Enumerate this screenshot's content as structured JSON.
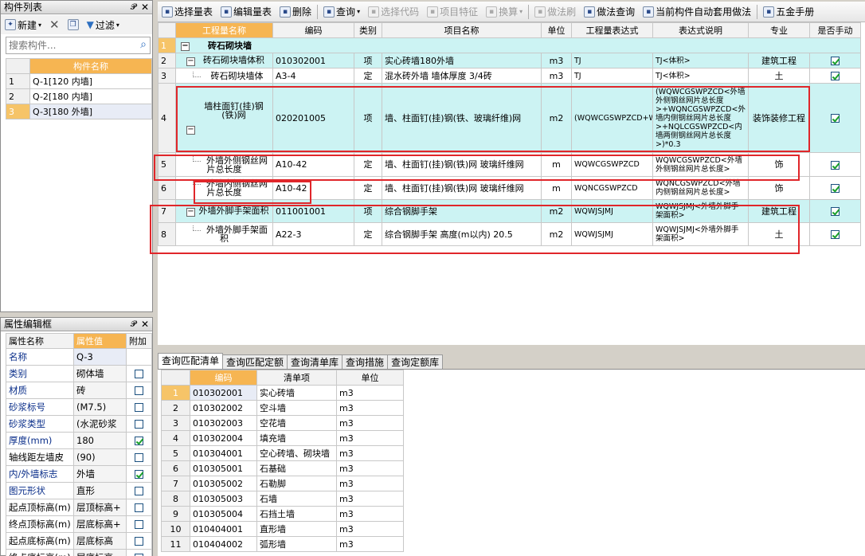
{
  "component_panel": {
    "title": "构件列表",
    "toolbar": {
      "new": "新建",
      "filter": "过滤"
    },
    "search_placeholder": "搜索构件...",
    "column": "构件名称",
    "items": [
      {
        "no": "1",
        "name": "Q-1[120 内墙]"
      },
      {
        "no": "2",
        "name": "Q-2[180 内墙]"
      },
      {
        "no": "3",
        "name": "Q-3[180 外墙]"
      }
    ]
  },
  "property_panel": {
    "title": "属性编辑框",
    "headers": {
      "name": "属性名称",
      "value": "属性值",
      "extra": "附加"
    },
    "rows": [
      {
        "name": "名称",
        "value": "Q-3",
        "check": null,
        "blue": true
      },
      {
        "name": "类别",
        "value": "砌体墙",
        "check": false,
        "blue": true
      },
      {
        "name": "材质",
        "value": "砖",
        "check": false,
        "blue": true
      },
      {
        "name": "砂浆标号",
        "value": "(M7.5)",
        "check": false,
        "blue": true
      },
      {
        "name": "砂浆类型",
        "value": "(水泥砂浆",
        "check": false,
        "blue": true
      },
      {
        "name": "厚度(mm)",
        "value": "180",
        "check": true,
        "blue": true
      },
      {
        "name": "轴线距左墙皮",
        "value": "(90)",
        "check": false,
        "blue": false
      },
      {
        "name": "内/外墙标志",
        "value": "外墙",
        "check": true,
        "blue": true
      },
      {
        "name": "图元形状",
        "value": "直形",
        "check": false,
        "blue": true
      },
      {
        "name": "起点顶标高(m)",
        "value": "层顶标高+",
        "check": false,
        "blue": false
      },
      {
        "name": "终点顶标高(m)",
        "value": "层底标高+",
        "check": false,
        "blue": false
      },
      {
        "name": "起点底标高(m)",
        "value": "层底标高",
        "check": false,
        "blue": false
      },
      {
        "name": "终点底标高(m)",
        "value": "层底标高",
        "check": false,
        "blue": false
      }
    ]
  },
  "main_toolbar": [
    {
      "label": "选择量表",
      "icon": "select-table-icon",
      "disabled": false
    },
    {
      "label": "编辑量表",
      "icon": "edit-table-icon",
      "disabled": false
    },
    {
      "label": "删除",
      "icon": "delete-icon",
      "disabled": false
    },
    {
      "label": "查询",
      "icon": "query-icon",
      "disabled": false,
      "dropdown": true
    },
    {
      "label": "选择代码",
      "icon": "select-code-icon",
      "disabled": true
    },
    {
      "label": "项目特征",
      "icon": "feature-icon",
      "disabled": true
    },
    {
      "label": "换算",
      "icon": "convert-icon",
      "disabled": true,
      "dropdown": true
    },
    {
      "label": "做法刷",
      "icon": "brush-icon",
      "disabled": true
    },
    {
      "label": "做法查询",
      "icon": "method-query-icon",
      "disabled": false
    },
    {
      "label": "当前构件自动套用做法",
      "icon": "auto-apply-icon",
      "disabled": false
    },
    {
      "label": "五金手册",
      "icon": "manual-icon",
      "disabled": false
    }
  ],
  "grid": {
    "headers": [
      "工程量名称",
      "编码",
      "类别",
      "项目名称",
      "单位",
      "工程量表达式",
      "表达式说明",
      "专业",
      "是否手动"
    ],
    "group": {
      "no": "1",
      "name": "砖石砌块墙"
    },
    "rows": [
      {
        "no": "2",
        "name": "砖石砌块墙体积",
        "code": "010302001",
        "type": "项",
        "proj": "实心砖墙180外墙",
        "unit": "m3",
        "expr": "TJ",
        "desc": "TJ<体积>",
        "spec": "建筑工程",
        "manual": true,
        "level": 1
      },
      {
        "no": "3",
        "name": "砖石砌块墙体",
        "code": "A3-4",
        "type": "定",
        "proj": "混水砖外墙 墙体厚度 3/4砖",
        "unit": "m3",
        "expr": "TJ",
        "desc": "TJ<体积>",
        "spec": "土",
        "manual": true,
        "level": 2
      },
      {
        "no": "4",
        "name": "墙柱面钉(挂)钢(铁)网",
        "code": "020201005",
        "type": "项",
        "proj": "墙、柱面钉(挂)钢(铁、玻璃纤维)网",
        "unit": "m2",
        "expr": "(WQWCGSWPZCD+WQNCGSWPZCD+NQLCGSWPZCD)*0.3",
        "desc": "(WQWCGSWPZCD<外墙外侧钢丝网片总长度>+WQNCGSWPZCD<外墙内侧钢丝网片总长度>+NQLCGSWPZCD<内墙两侧钢丝网片总长度>)*0.3",
        "spec": "装饰装修工程",
        "manual": true,
        "level": 1
      },
      {
        "no": "5",
        "name": "外墙外侧钢丝网片总长度",
        "code": "A10-42",
        "type": "定",
        "proj": "墙、柱面钉(挂)钢(铁)网 玻璃纤维网",
        "unit": "m",
        "expr": "WQWCGSWPZCD",
        "desc": "WQWCGSWPZCD<外墙外侧钢丝网片总长度>",
        "spec": "饰",
        "manual": true,
        "level": 2
      },
      {
        "no": "6",
        "name": "外墙内侧钢丝网片总长度",
        "code": "A10-42",
        "type": "定",
        "proj": "墙、柱面钉(挂)钢(铁)网 玻璃纤维网",
        "unit": "m",
        "expr": "WQNCGSWPZCD",
        "desc": "WQNCGSWPZCD<外墙内侧钢丝网片总长度>",
        "spec": "饰",
        "manual": true,
        "level": 2
      },
      {
        "no": "7",
        "name": "外墙外脚手架面积",
        "code": "011001001",
        "type": "项",
        "proj": "综合钢脚手架",
        "unit": "m2",
        "expr": "WQWJSJMJ",
        "desc": "WQWJSJMJ<外墙外脚手架面积>",
        "spec": "建筑工程",
        "manual": true,
        "level": 1
      },
      {
        "no": "8",
        "name": "外墙外脚手架面积",
        "code": "A22-3",
        "type": "定",
        "proj": "综合钢脚手架 高度(m以内) 20.5",
        "unit": "m2",
        "expr": "WQWJSJMJ",
        "desc": "WQWJSJMJ<外墙外脚手架面积>",
        "spec": "土",
        "manual": true,
        "level": 2
      }
    ]
  },
  "bottom_tabs": [
    "查询匹配清单",
    "查询匹配定额",
    "查询清单库",
    "查询措施",
    "查询定额库"
  ],
  "bottom_grid": {
    "headers": [
      "编码",
      "清单项",
      "单位"
    ],
    "rows": [
      {
        "no": "1",
        "code": "010302001",
        "item": "实心砖墙",
        "unit": "m3"
      },
      {
        "no": "2",
        "code": "010302002",
        "item": "空斗墙",
        "unit": "m3"
      },
      {
        "no": "3",
        "code": "010302003",
        "item": "空花墙",
        "unit": "m3"
      },
      {
        "no": "4",
        "code": "010302004",
        "item": "填充墙",
        "unit": "m3"
      },
      {
        "no": "5",
        "code": "010304001",
        "item": "空心砖墙、砌块墙",
        "unit": "m3"
      },
      {
        "no": "6",
        "code": "010305001",
        "item": "石基础",
        "unit": "m3"
      },
      {
        "no": "7",
        "code": "010305002",
        "item": "石勒脚",
        "unit": "m3"
      },
      {
        "no": "8",
        "code": "010305003",
        "item": "石墙",
        "unit": "m3"
      },
      {
        "no": "9",
        "code": "010305004",
        "item": "石挡土墙",
        "unit": "m3"
      },
      {
        "no": "10",
        "code": "010404001",
        "item": "直形墙",
        "unit": "m3"
      },
      {
        "no": "11",
        "code": "010404002",
        "item": "弧形墙",
        "unit": "m3"
      }
    ]
  },
  "colors": {
    "header_accent": "#f6b552",
    "highlight_row": "#ccf3f3",
    "annotation_box": "#e0262a"
  }
}
